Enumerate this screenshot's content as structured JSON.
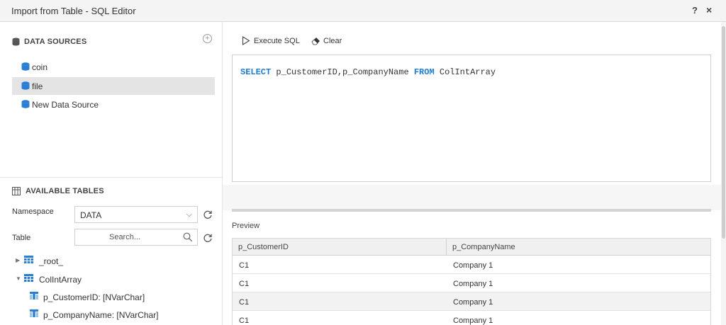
{
  "window": {
    "title": "Import from Table - SQL Editor",
    "help_label": "?",
    "close_label": "×"
  },
  "data_sources": {
    "header": "DATA SOURCES",
    "add_label": "+",
    "items": [
      {
        "label": "coin",
        "selected": false
      },
      {
        "label": "file",
        "selected": true
      },
      {
        "label": "New Data Source",
        "selected": false
      }
    ]
  },
  "available_tables": {
    "header": "AVAILABLE TABLES",
    "namespace_label": "Namespace",
    "namespace_value": "DATA",
    "table_label": "Table",
    "search_placeholder": "Search...",
    "tree": [
      {
        "label": "_root_",
        "expanded": false,
        "level": 0,
        "kind": "table"
      },
      {
        "label": "ColIntArray",
        "expanded": true,
        "level": 0,
        "kind": "table"
      },
      {
        "label": "p_CustomerID: [NVarChar]",
        "level": 1,
        "kind": "column"
      },
      {
        "label": "p_CompanyName: [NVarChar]",
        "level": 1,
        "kind": "column"
      }
    ]
  },
  "toolbar": {
    "execute_label": "Execute SQL",
    "clear_label": "Clear"
  },
  "editor": {
    "kw_select": "SELECT",
    "columns": " p_CustomerID,p_CompanyName ",
    "kw_from": "FROM",
    "table": " ColIntArray"
  },
  "preview": {
    "label": "Preview",
    "columns": [
      "p_CustomerID",
      "p_CompanyName"
    ],
    "rows": [
      [
        "C1",
        "Company 1"
      ],
      [
        "C1",
        "Company 1"
      ],
      [
        "C1",
        "Company 1"
      ],
      [
        "C1",
        "Company 1"
      ]
    ]
  },
  "colors": {
    "keyword": "#1e7bd1",
    "db_icon": "#2a7fd4",
    "selected_row": "#e4e4e4"
  }
}
